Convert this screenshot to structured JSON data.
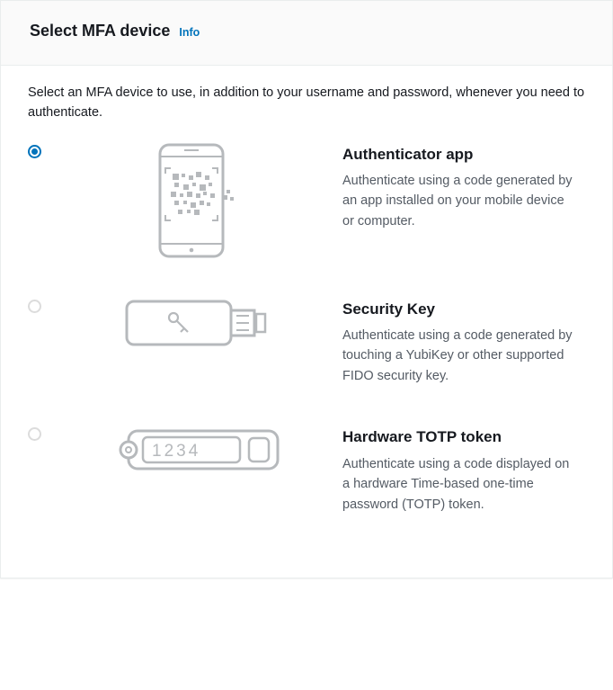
{
  "header": {
    "title": "Select MFA device",
    "info_label": "Info"
  },
  "intro": "Select an MFA device to use, in addition to your username and password, whenever you need to authenticate.",
  "options": {
    "authenticator": {
      "title": "Authenticator app",
      "description": "Authenticate using a code generated by an app installed on your mobile device or computer.",
      "selected": true
    },
    "security_key": {
      "title": "Security Key",
      "description": "Authenticate using a code generated by touching a YubiKey or other supported FIDO security key.",
      "selected": false
    },
    "hardware_token": {
      "title": "Hardware TOTP token",
      "description": "Authenticate using a code displayed on a hardware Time-based one-time password (TOTP) token.",
      "selected": false,
      "display_code": "1234"
    }
  }
}
